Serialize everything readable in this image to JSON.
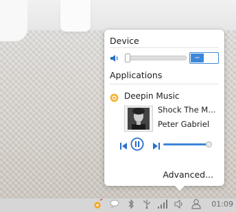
{
  "desktop": {},
  "popup": {
    "device_header": "Device",
    "applications_header": "Applications",
    "device_toggle_symbol": "−",
    "device_volume": 0.02,
    "app": {
      "name": "Deepin Music",
      "song_title": "Shock The M...",
      "artist": "Peter Gabriel",
      "volume": 1.0
    },
    "advanced_label": "Advanced..."
  },
  "taskbar": {
    "clock": "01:09",
    "tray_icons": [
      "deepin-music-icon",
      "chat-icon",
      "bluetooth-icon",
      "usb-icon",
      "network-signal-icon",
      "volume-icon",
      "user-icon"
    ]
  },
  "colors": {
    "accent": "#3e86d8",
    "popup_bg": "#ffffff",
    "taskbar_bg": "#d6d6d6"
  }
}
